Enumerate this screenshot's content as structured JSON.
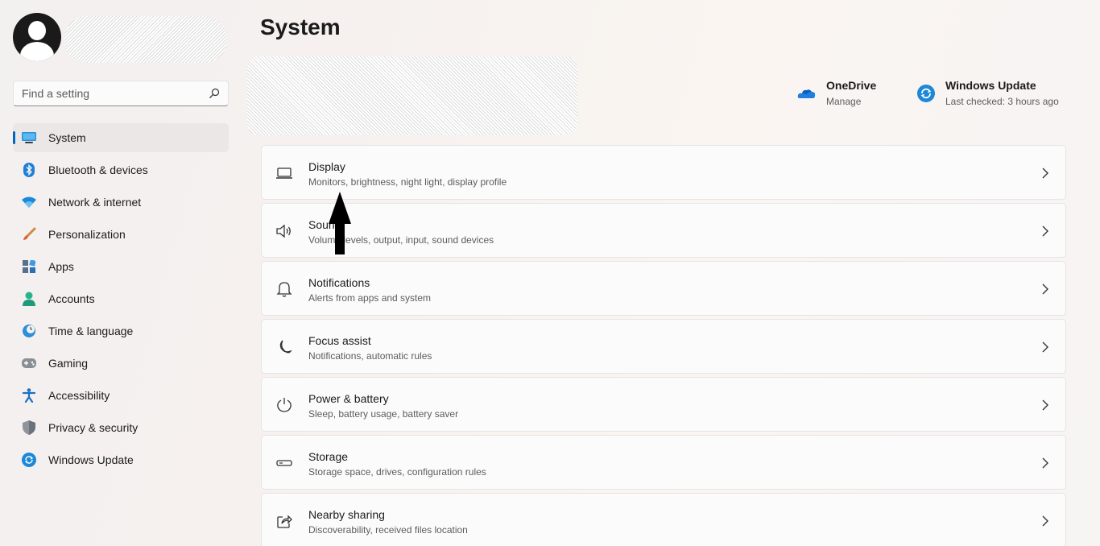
{
  "sidebar": {
    "search": {
      "placeholder": "Find a setting"
    },
    "items": [
      {
        "label": "System",
        "icon": "monitor-icon",
        "active": true
      },
      {
        "label": "Bluetooth & devices",
        "icon": "bluetooth-icon"
      },
      {
        "label": "Network & internet",
        "icon": "wifi-icon"
      },
      {
        "label": "Personalization",
        "icon": "brush-icon"
      },
      {
        "label": "Apps",
        "icon": "apps-icon"
      },
      {
        "label": "Accounts",
        "icon": "person-icon"
      },
      {
        "label": "Time & language",
        "icon": "clock-globe-icon"
      },
      {
        "label": "Gaming",
        "icon": "gamepad-icon"
      },
      {
        "label": "Accessibility",
        "icon": "accessibility-icon"
      },
      {
        "label": "Privacy & security",
        "icon": "shield-icon"
      },
      {
        "label": "Windows Update",
        "icon": "update-icon"
      }
    ]
  },
  "main": {
    "title": "System",
    "quick_links": [
      {
        "title": "OneDrive",
        "subtitle": "Manage",
        "icon": "cloud-icon"
      },
      {
        "title": "Windows Update",
        "subtitle": "Last checked: 3 hours ago",
        "icon": "update-icon"
      }
    ],
    "cards": [
      {
        "title": "Display",
        "subtitle": "Monitors, brightness, night light, display profile",
        "icon": "display-icon"
      },
      {
        "title": "Sound",
        "subtitle": "Volume levels, output, input, sound devices",
        "icon": "speaker-icon"
      },
      {
        "title": "Notifications",
        "subtitle": "Alerts from apps and system",
        "icon": "bell-icon"
      },
      {
        "title": "Focus assist",
        "subtitle": "Notifications, automatic rules",
        "icon": "moon-icon"
      },
      {
        "title": "Power & battery",
        "subtitle": "Sleep, battery usage, battery saver",
        "icon": "power-icon"
      },
      {
        "title": "Storage",
        "subtitle": "Storage space, drives, configuration rules",
        "icon": "drive-icon"
      },
      {
        "title": "Nearby sharing",
        "subtitle": "Discoverability, received files location",
        "icon": "share-icon"
      }
    ]
  },
  "colors": {
    "accent": "#0067c0",
    "card_bg": "#fbfbfb"
  }
}
